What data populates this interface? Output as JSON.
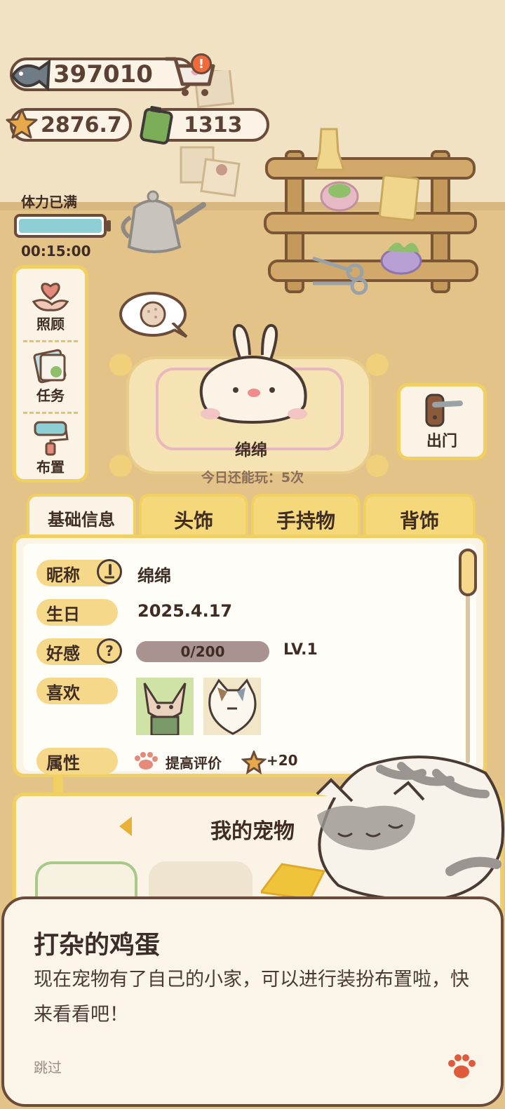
{
  "currencies": {
    "fish": "397010",
    "star": "2876.7",
    "battery": "1313"
  },
  "stamina": {
    "label": "体力已满",
    "timer": "00:15:00",
    "level": 1.0
  },
  "side_menu": [
    {
      "label": "照顾",
      "icon": "heart-hand-icon"
    },
    {
      "label": "任务",
      "icon": "clipboard-icon"
    },
    {
      "label": "布置",
      "icon": "paint-roller-icon"
    }
  ],
  "go_out": {
    "label": "出门",
    "icon": "door-handle-icon"
  },
  "pet": {
    "name": "绵绵",
    "play_remaining": "今日还能玩：5次"
  },
  "tabs": [
    {
      "label": "基础信息",
      "active": true
    },
    {
      "label": "头饰",
      "active": false
    },
    {
      "label": "手持物",
      "active": false
    },
    {
      "label": "背饰",
      "active": false
    }
  ],
  "info": {
    "nickname_key": "昵称",
    "nickname_val": "绵绵",
    "birthday_key": "生日",
    "birthday_val": "2025.4.17",
    "affection_key": "好感",
    "affection_val": "0/200",
    "affection_level": "LV.1",
    "likes_key": "喜欢",
    "attr_key": "属性",
    "attr_val": "提高评价",
    "attr_bonus": "+20"
  },
  "my_pets": {
    "title": "我的宠物"
  },
  "dialog": {
    "title": "打杂的鸡蛋",
    "body": "现在宠物有了自己的小家，可以进行装扮布置啦，快来看看吧！",
    "skip": "跳过"
  },
  "colors": {
    "outline": "#6b4b3a",
    "panel_border": "#f0cf63",
    "panel_bg": "#fbf4e6",
    "stamina": "#8ecfd6",
    "affection_bar": "#a99391"
  }
}
